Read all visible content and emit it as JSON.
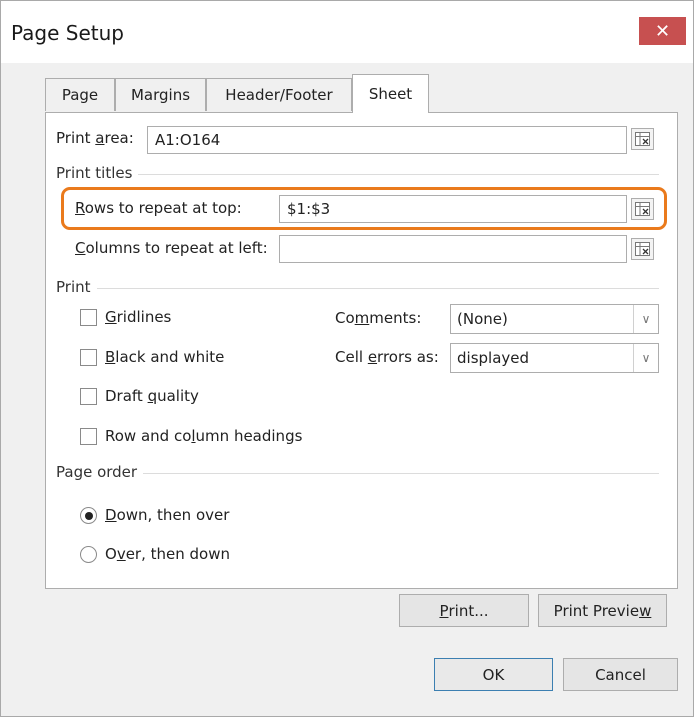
{
  "window": {
    "title": "Page Setup",
    "close_glyph": "✕"
  },
  "tabs": [
    {
      "label": "Page",
      "active": false
    },
    {
      "label": "Margins",
      "active": false
    },
    {
      "label": "Header/Footer",
      "active": false
    },
    {
      "label": "Sheet",
      "active": true
    }
  ],
  "print_area": {
    "label_pre": "Print ",
    "label_u": "a",
    "label_post": "rea:",
    "value": "A1:O164"
  },
  "print_titles": {
    "section": "Print titles",
    "rows": {
      "label_u": "R",
      "label_post": "ows to repeat at top:",
      "value": "$1:$3"
    },
    "columns": {
      "label_u": "C",
      "label_post": "olumns to repeat at left:",
      "value": ""
    }
  },
  "print": {
    "section": "Print",
    "gridlines": {
      "label_u": "G",
      "label_post": "ridlines",
      "checked": false
    },
    "black_white": {
      "label_u": "B",
      "label_post": "lack and white",
      "checked": false
    },
    "draft": {
      "label_pre": "Draft ",
      "label_u": "q",
      "label_post": "uality",
      "checked": false
    },
    "headings": {
      "label_pre": "Row and co",
      "label_u": "l",
      "label_post": "umn headings",
      "checked": false
    },
    "comments": {
      "label_pre": "Co",
      "label_u": "m",
      "label_post": "ments:",
      "value": "(None)"
    },
    "cell_errors": {
      "label_pre": "Cell ",
      "label_u": "e",
      "label_post": "rrors as:",
      "value": "displayed"
    }
  },
  "page_order": {
    "section": "Page order",
    "down_then_over": {
      "label_u": "D",
      "label_post": "own, then over",
      "selected": true
    },
    "over_then_down": {
      "label_pre": "O",
      "label_u": "v",
      "label_post": "er, then down",
      "selected": false
    }
  },
  "buttons": {
    "print": {
      "label_u": "P",
      "label_post": "rint..."
    },
    "print_preview": {
      "label_pre": "Print Previe",
      "label_u": "w"
    },
    "ok": "OK",
    "cancel": "Cancel"
  },
  "icons": {
    "range_selector": "range-collapse-icon",
    "dropdown": "chevron-down-icon"
  },
  "colors": {
    "highlight": "#ea7a1c",
    "close": "#c75050",
    "default_button_border": "#3c7fb1"
  }
}
